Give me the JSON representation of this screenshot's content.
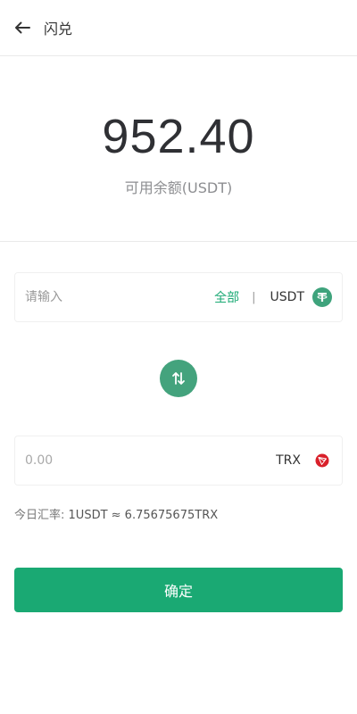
{
  "header": {
    "back_icon": "arrow-left-icon",
    "title": "闪兑"
  },
  "balance": {
    "amount": "952.40",
    "label": "可用余额(USDT)"
  },
  "from": {
    "placeholder": "请输入",
    "all_label": "全部",
    "divider": "|",
    "currency": "USDT",
    "icon": "tether-icon",
    "icon_color": "#3ea37c"
  },
  "swap": {
    "icon": "swap-arrows-icon",
    "color": "#44a37d"
  },
  "to": {
    "amount": "0.00",
    "currency": "TRX",
    "icon": "tron-icon",
    "icon_color": "#d9202a"
  },
  "rate": {
    "label": "今日汇率:",
    "value": "1USDT ≈ 6.75675675TRX"
  },
  "confirm_label": "确定",
  "colors": {
    "accent": "#1aa973"
  }
}
